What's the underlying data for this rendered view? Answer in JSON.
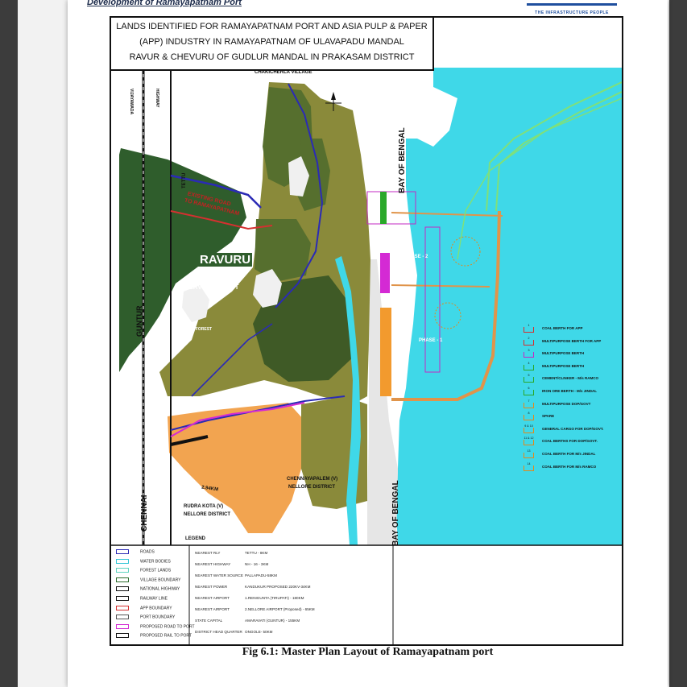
{
  "viewer": {
    "shade": "#3c3c3c"
  },
  "page": {
    "header_text": "Development of Ramayapatnam Port",
    "brand_sub": "THE INFRASTRUCTURE PEOPLE"
  },
  "figure": {
    "title_lines": [
      "LANDS IDENTIFIED FOR RAMAYAPATNAM PORT AND ASIA PULP & PAPER",
      "(APP) INDUSTRY IN RAMAYAPATNAM OF ULAVAPADU MANDAL",
      "RAVUR & CHEVURU OF GUDLUR MANDAL IN PRAKASAM  DISTRICT"
    ],
    "caption": "Fig 6.1: Master Plan Layout of Ramayapatnam port"
  },
  "map_labels": {
    "village_top": "CHAKICHERLA VILLAGE",
    "vijayawada": "VIJAYAWADA",
    "highway": "HIGHWAY",
    "tettu": "TETTU",
    "existing_road": "EXISTING ROAD",
    "to_port": "TO RAMAYAPATNAM",
    "ravuru": "RAVURU",
    "forest_num": "604",
    "reserved_forest": "RESERVED FOREST",
    "guntur": "GUNTUR",
    "nh16": "NH - 16",
    "reserved_forest_small": "RESERVED FOREST",
    "chennai": "CHENNAI",
    "chennayapalem_1": "CHENNAYAPALEM (V)",
    "chennayapalem_2": "NELLORE DISTRICT",
    "rudra_1": "RUDRA KOTA (V)",
    "rudra_2": "NELLORE DISTRICT",
    "bay_top": "BAY OF BENGAL",
    "bay_bottom": "BAY OF BENGAL",
    "phase2": "PHASE - 2",
    "phase1": "PHASE - 1",
    "legend": "LEGEND",
    "distance": "2.94KM"
  },
  "legend": [
    {
      "label": "ROADS",
      "color": "#2b2bb5"
    },
    {
      "label": "WATER BODIES",
      "color": "#34c6d6"
    },
    {
      "label": "FOREST LANDS",
      "color": "#5fd3c0"
    },
    {
      "label": "VILLAGE BOUNDARY",
      "color": "#2a6b2a"
    },
    {
      "label": "NATIONAL HIGHWAY",
      "color": "#111111"
    },
    {
      "label": "RAILWAY LINE",
      "color": "#111111"
    },
    {
      "label": "APP BOUNDARY",
      "color": "#d43030"
    },
    {
      "label": "PORT BOUNDARY",
      "color": "#555555"
    },
    {
      "label": "PROPOSED ROAD TO PORT",
      "color": "#d42ad4"
    },
    {
      "label": "PROPOSED RAIL TO PORT",
      "color": "#111111"
    }
  ],
  "nearest_info": [
    {
      "key": "NEAREST RLY",
      "value": "TETTU - 8KM"
    },
    {
      "key": "NEAREST HIGHWAY",
      "value": "NH - 16 - 3KM"
    },
    {
      "key": "NEAREST WATER SOURCE",
      "value": "PALLAPADU-58KM"
    },
    {
      "key": "NEAREST POWER",
      "value": "KANDUKUR PROPOSED 220KV-34KM"
    },
    {
      "key": "NEAREST AIRPORT",
      "value": "1.RENIGUNTA (TIRUPATI) - 180KM"
    },
    {
      "key": "NEAREST AIRPORT",
      "value": "2.NELLORE AIRPORT (Proposed) - 65KM"
    },
    {
      "key": "STATE CAPITAL",
      "value": "AMARAVATI (GUNTUR) - 155KM"
    },
    {
      "key": "DISTRICT HEAD QUARTER",
      "value": "ONGOLE- 50KM"
    }
  ],
  "berth_legend": [
    {
      "num": "1",
      "label": "COAL BERTH FOR APP",
      "color": "#d43030"
    },
    {
      "num": "2",
      "label": "MULTIPURPOSE BERTH FOR APP",
      "color": "#d43030"
    },
    {
      "num": "3",
      "label": "MULTIPURPOSE BERTH",
      "color": "#c32ac3"
    },
    {
      "num": "4",
      "label": "MULTIPURPOSE BERTH",
      "color": "#2aa82a"
    },
    {
      "num": "5",
      "label": "CEMENT/CLINKER - M/s RAMCO",
      "color": "#2aa82a"
    },
    {
      "num": "6",
      "label": "IRON ORE BERTH - M/s JINDAL",
      "color": "#2aa82a"
    },
    {
      "num": "7",
      "label": "MULTIPURPOSE  DOP/GOVT",
      "color": "#e08a1e"
    },
    {
      "num": "8",
      "label": "SPARE",
      "color": "#e08a1e"
    },
    {
      "num": "9 & 10",
      "label": "GENERAL CARGO FOR DOP/GOVT.",
      "color": "#e08a1e"
    },
    {
      "num": "11 & 12",
      "label": "COAL BERTHS FOR DOP/GOVT.",
      "color": "#e08a1e"
    },
    {
      "num": "13",
      "label": "COAL BERTH FOR M/s JINDAL",
      "color": "#e08a1e"
    },
    {
      "num": "14",
      "label": "COAL BERTH FOR M/s RAMCO",
      "color": "#e08a1e"
    }
  ],
  "colors": {
    "sea": "#3fd8e8",
    "forest_dark": "#2f5d2c",
    "land_olive": "#8a8a3a",
    "land_green": "#566f2e",
    "land_orange": "#f2a450",
    "sand": "#e6e6e6",
    "port_orange": "#f29a2e",
    "road": "#2b2bb5",
    "proposed_road": "#d42ad4",
    "rail_proposed": "#7fe07a"
  }
}
